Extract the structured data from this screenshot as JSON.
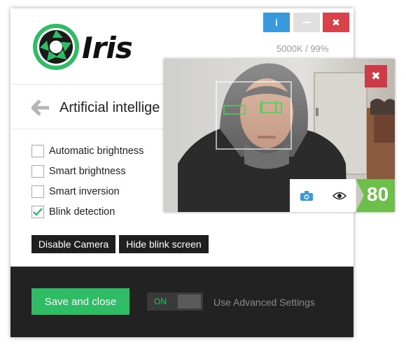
{
  "window": {
    "buttons": {
      "info": "i",
      "close": "✖"
    },
    "brand": "Iris",
    "status_temp": "5000K / 99%",
    "section_title": "Artificial intellige",
    "options": [
      {
        "label": "Automatic brightness",
        "checked": false
      },
      {
        "label": "Smart brightness",
        "checked": false
      },
      {
        "label": "Smart inversion",
        "checked": false
      },
      {
        "label": "Blink detection",
        "checked": true
      }
    ],
    "disable_camera": "Disable Camera",
    "hide_blink": "Hide blink screen"
  },
  "footer": {
    "save_label": "Save and close",
    "toggle_label": "ON",
    "advanced_label": "Use Advanced Settings"
  },
  "camera": {
    "close": "✖",
    "score": "80"
  },
  "icons": {
    "logo": "aperture-logo-icon",
    "back": "back-arrow-icon",
    "camera": "camera-icon",
    "eye": "eye-icon"
  },
  "colors": {
    "accent_green": "#2ebd64",
    "info_blue": "#3a98dc",
    "close_red": "#d9414b",
    "footer_dark": "#222222"
  }
}
